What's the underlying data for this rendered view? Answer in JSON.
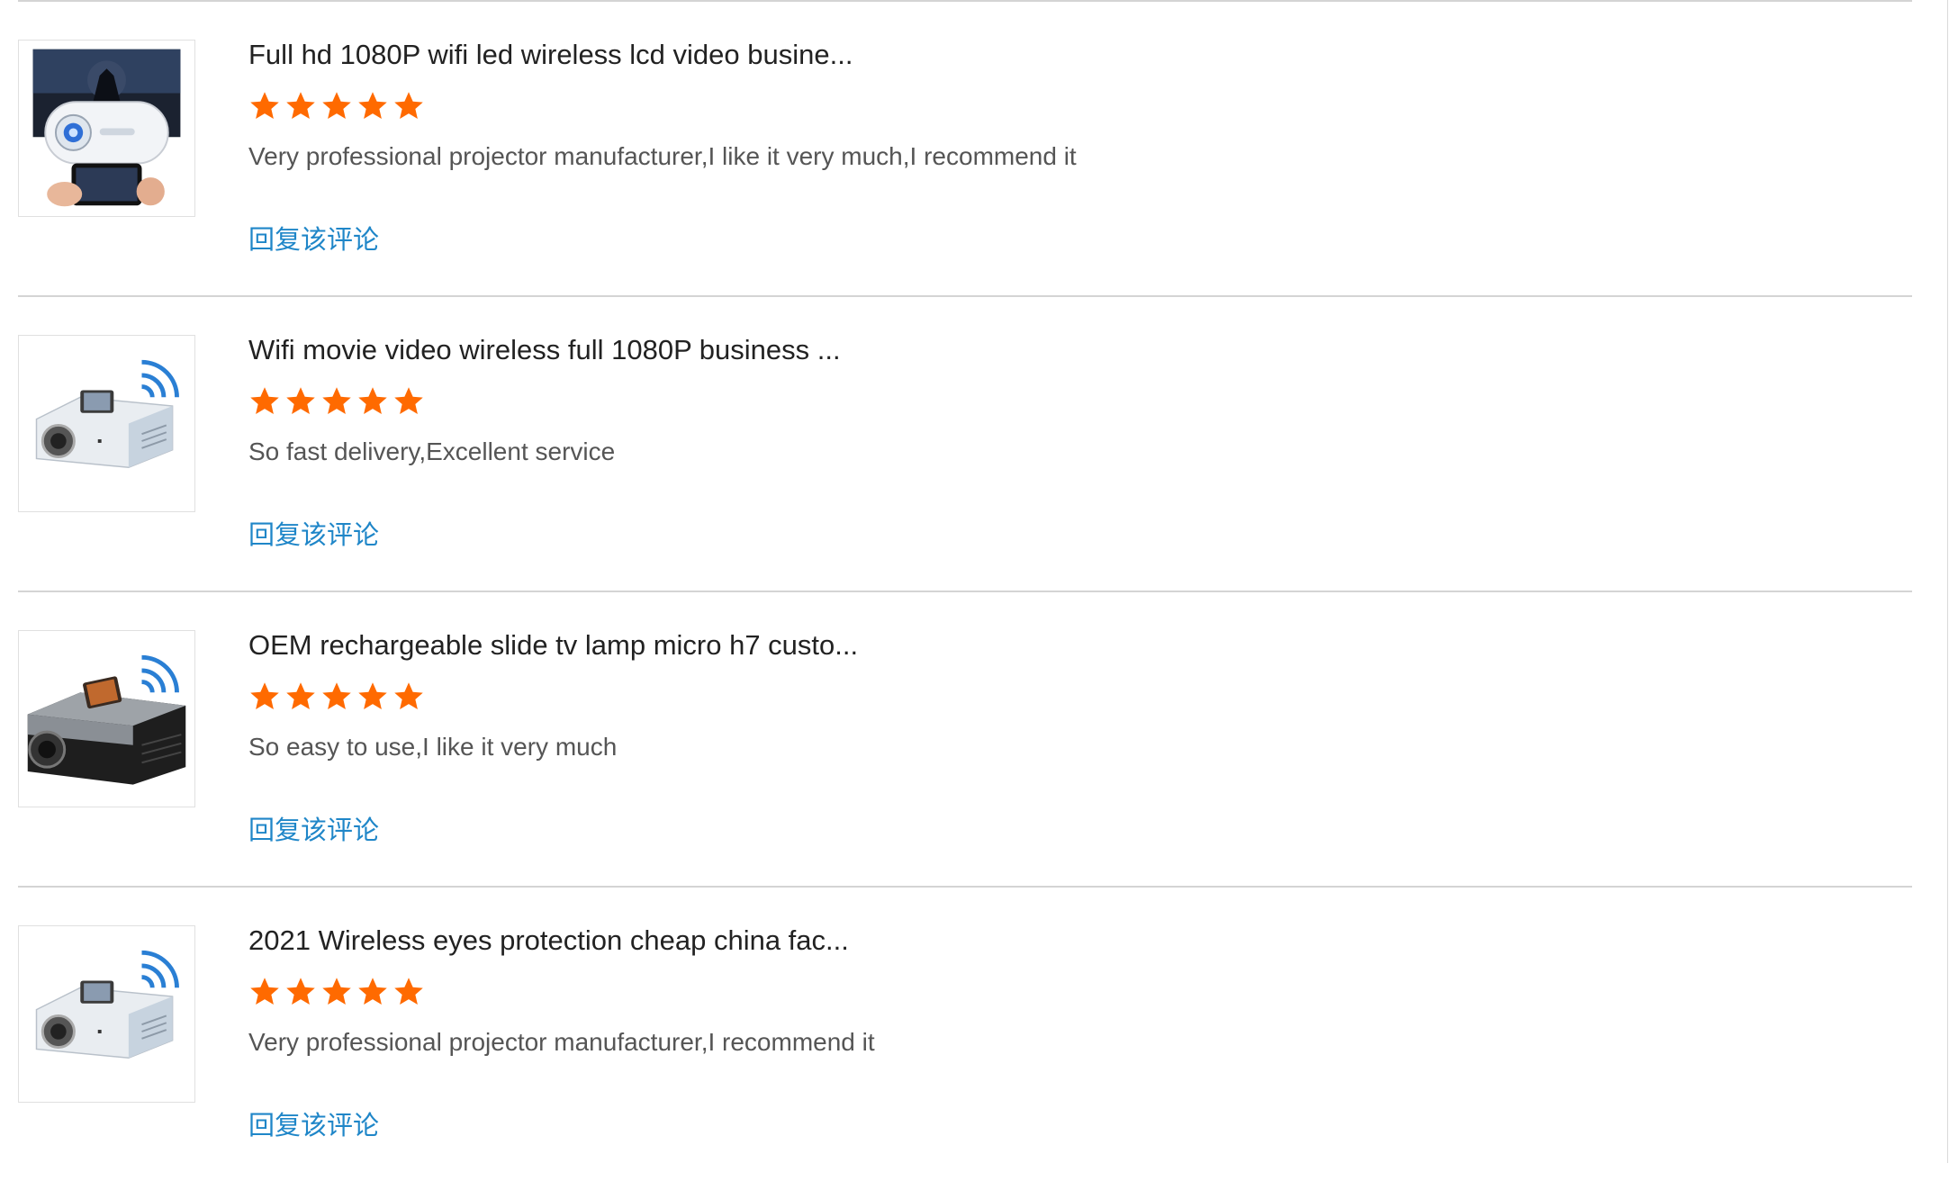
{
  "colors": {
    "star": "#ff6a00",
    "reply_link": "#1f86c8",
    "divider": "#d4d4d4"
  },
  "reviews": [
    {
      "title": "Full hd 1080P wifi led wireless lcd video busine...",
      "rating": 5,
      "rating_max": 5,
      "comment": "Very professional projector manufacturer,I like it very much,I recommend it",
      "reply_label": "回复该评论",
      "image": "white-mini-projector-with-phone"
    },
    {
      "title": "Wifi movie video wireless full 1080P business ...",
      "rating": 5,
      "rating_max": 5,
      "comment": "So fast delivery,Excellent service",
      "reply_label": "回复该评论",
      "image": "silver-wifi-projector"
    },
    {
      "title": "OEM rechargeable slide tv lamp micro h7 custo...",
      "rating": 5,
      "rating_max": 5,
      "comment": "So easy to use,I like it very much",
      "reply_label": "回复该评论",
      "image": "black-silver-wifi-projector"
    },
    {
      "title": "2021 Wireless eyes protection cheap china fac...",
      "rating": 5,
      "rating_max": 5,
      "comment": "Very professional projector manufacturer,I recommend it",
      "reply_label": "回复该评论",
      "image": "silver-wifi-projector"
    }
  ]
}
